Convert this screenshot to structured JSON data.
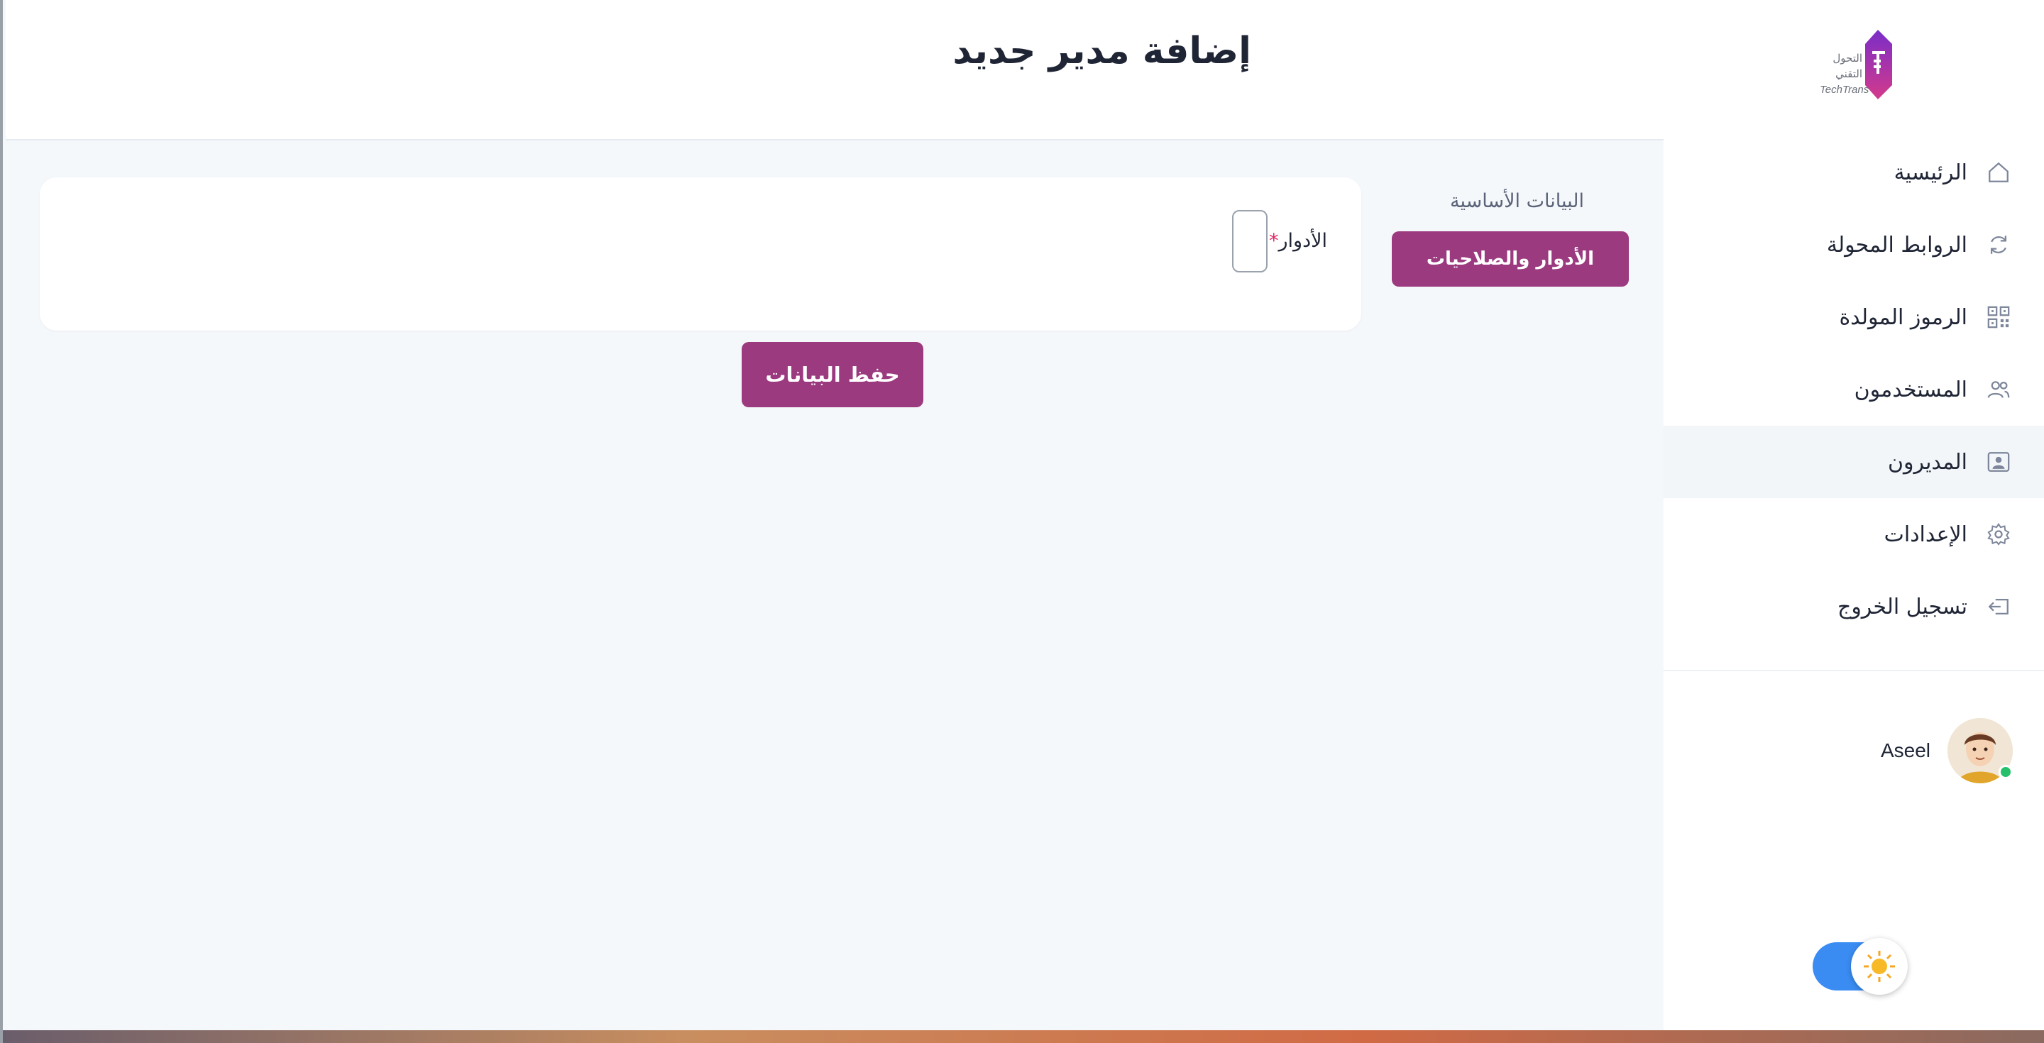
{
  "app": {
    "logo_text_ar": "التحول التقني",
    "logo_text_en": "TechTrans"
  },
  "header": {
    "title": "إضافة مدير جديد"
  },
  "sidebar": {
    "items": [
      {
        "label": "الرئيسية",
        "icon": "home-icon",
        "active": false
      },
      {
        "label": "الروابط المحولة",
        "icon": "refresh-icon",
        "active": false
      },
      {
        "label": "الرموز المولدة",
        "icon": "qr-code-icon",
        "active": false
      },
      {
        "label": "المستخدمون",
        "icon": "users-icon",
        "active": false
      },
      {
        "label": "المديرون",
        "icon": "admin-badge-icon",
        "active": true
      },
      {
        "label": "الإعدادات",
        "icon": "gear-icon",
        "active": false
      },
      {
        "label": "تسجيل الخروج",
        "icon": "logout-icon",
        "active": false
      }
    ],
    "user": {
      "name": "Aseel",
      "status": "online"
    },
    "theme_toggle": {
      "mode": "light",
      "icon": "sun-icon"
    }
  },
  "form": {
    "section_heading": "البيانات الأساسية",
    "active_tab": "الأدوار والصلاحيات",
    "roles_label": "الأدوار",
    "required_mark": "*",
    "roles_value": "",
    "save_label": "حفظ البيانات"
  },
  "colors": {
    "accent": "#9b3a7f",
    "toggle": "#3a8cf3",
    "background": "#f5f8fb"
  }
}
